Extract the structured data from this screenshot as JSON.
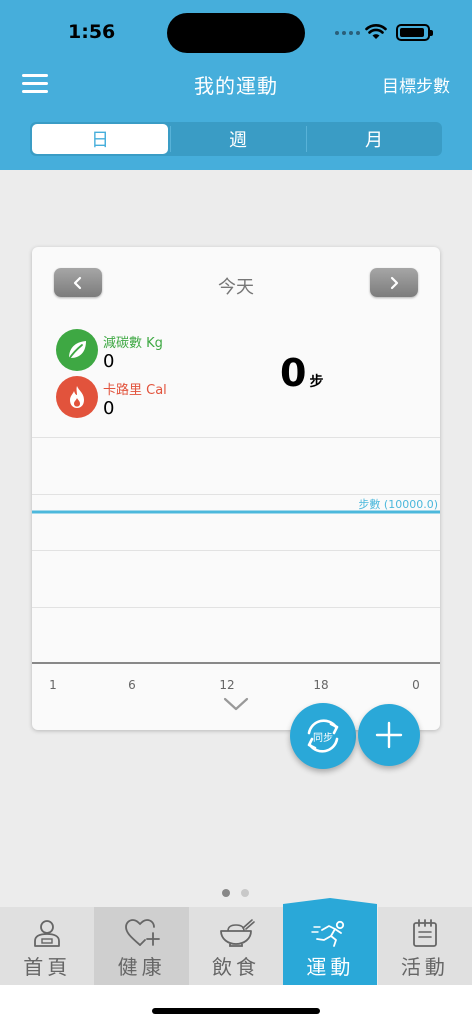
{
  "status_bar": {
    "time": "1:56"
  },
  "nav": {
    "title": "我的運動",
    "goal_label": "目標步數"
  },
  "segments": [
    {
      "label": "日",
      "active": true
    },
    {
      "label": "週",
      "active": false
    },
    {
      "label": "月",
      "active": false
    }
  ],
  "card": {
    "day_label": "今天",
    "carbon": {
      "label": "減碳數 Kg",
      "value": "0"
    },
    "calorie": {
      "label": "卡路里 Cal",
      "value": "0"
    },
    "steps": {
      "value": "0",
      "unit": "步"
    }
  },
  "chart_data": {
    "type": "line",
    "x_ticks": [
      "1",
      "6",
      "12",
      "18",
      "0"
    ],
    "values": [],
    "target_line": {
      "label": "步數 (10000.0)",
      "value": 10000
    },
    "grid": true
  },
  "fab": {
    "sync_label": "同步"
  },
  "page_indicator": {
    "count": 2,
    "active_index": 0
  },
  "tabs": [
    {
      "label": "首頁",
      "icon": "person-icon"
    },
    {
      "label": "健康",
      "icon": "heart-plus-icon"
    },
    {
      "label": "飲食",
      "icon": "bowl-icon"
    },
    {
      "label": "運動",
      "icon": "running-icon",
      "active": true
    },
    {
      "label": "活動",
      "icon": "calendar-icon"
    }
  ],
  "colors": {
    "primary": "#46aedb",
    "carbon_green": "#3ea843",
    "calorie_red": "#e2533c",
    "target_line": "#4cb8dc",
    "fab_blue": "#2aa8d8"
  }
}
